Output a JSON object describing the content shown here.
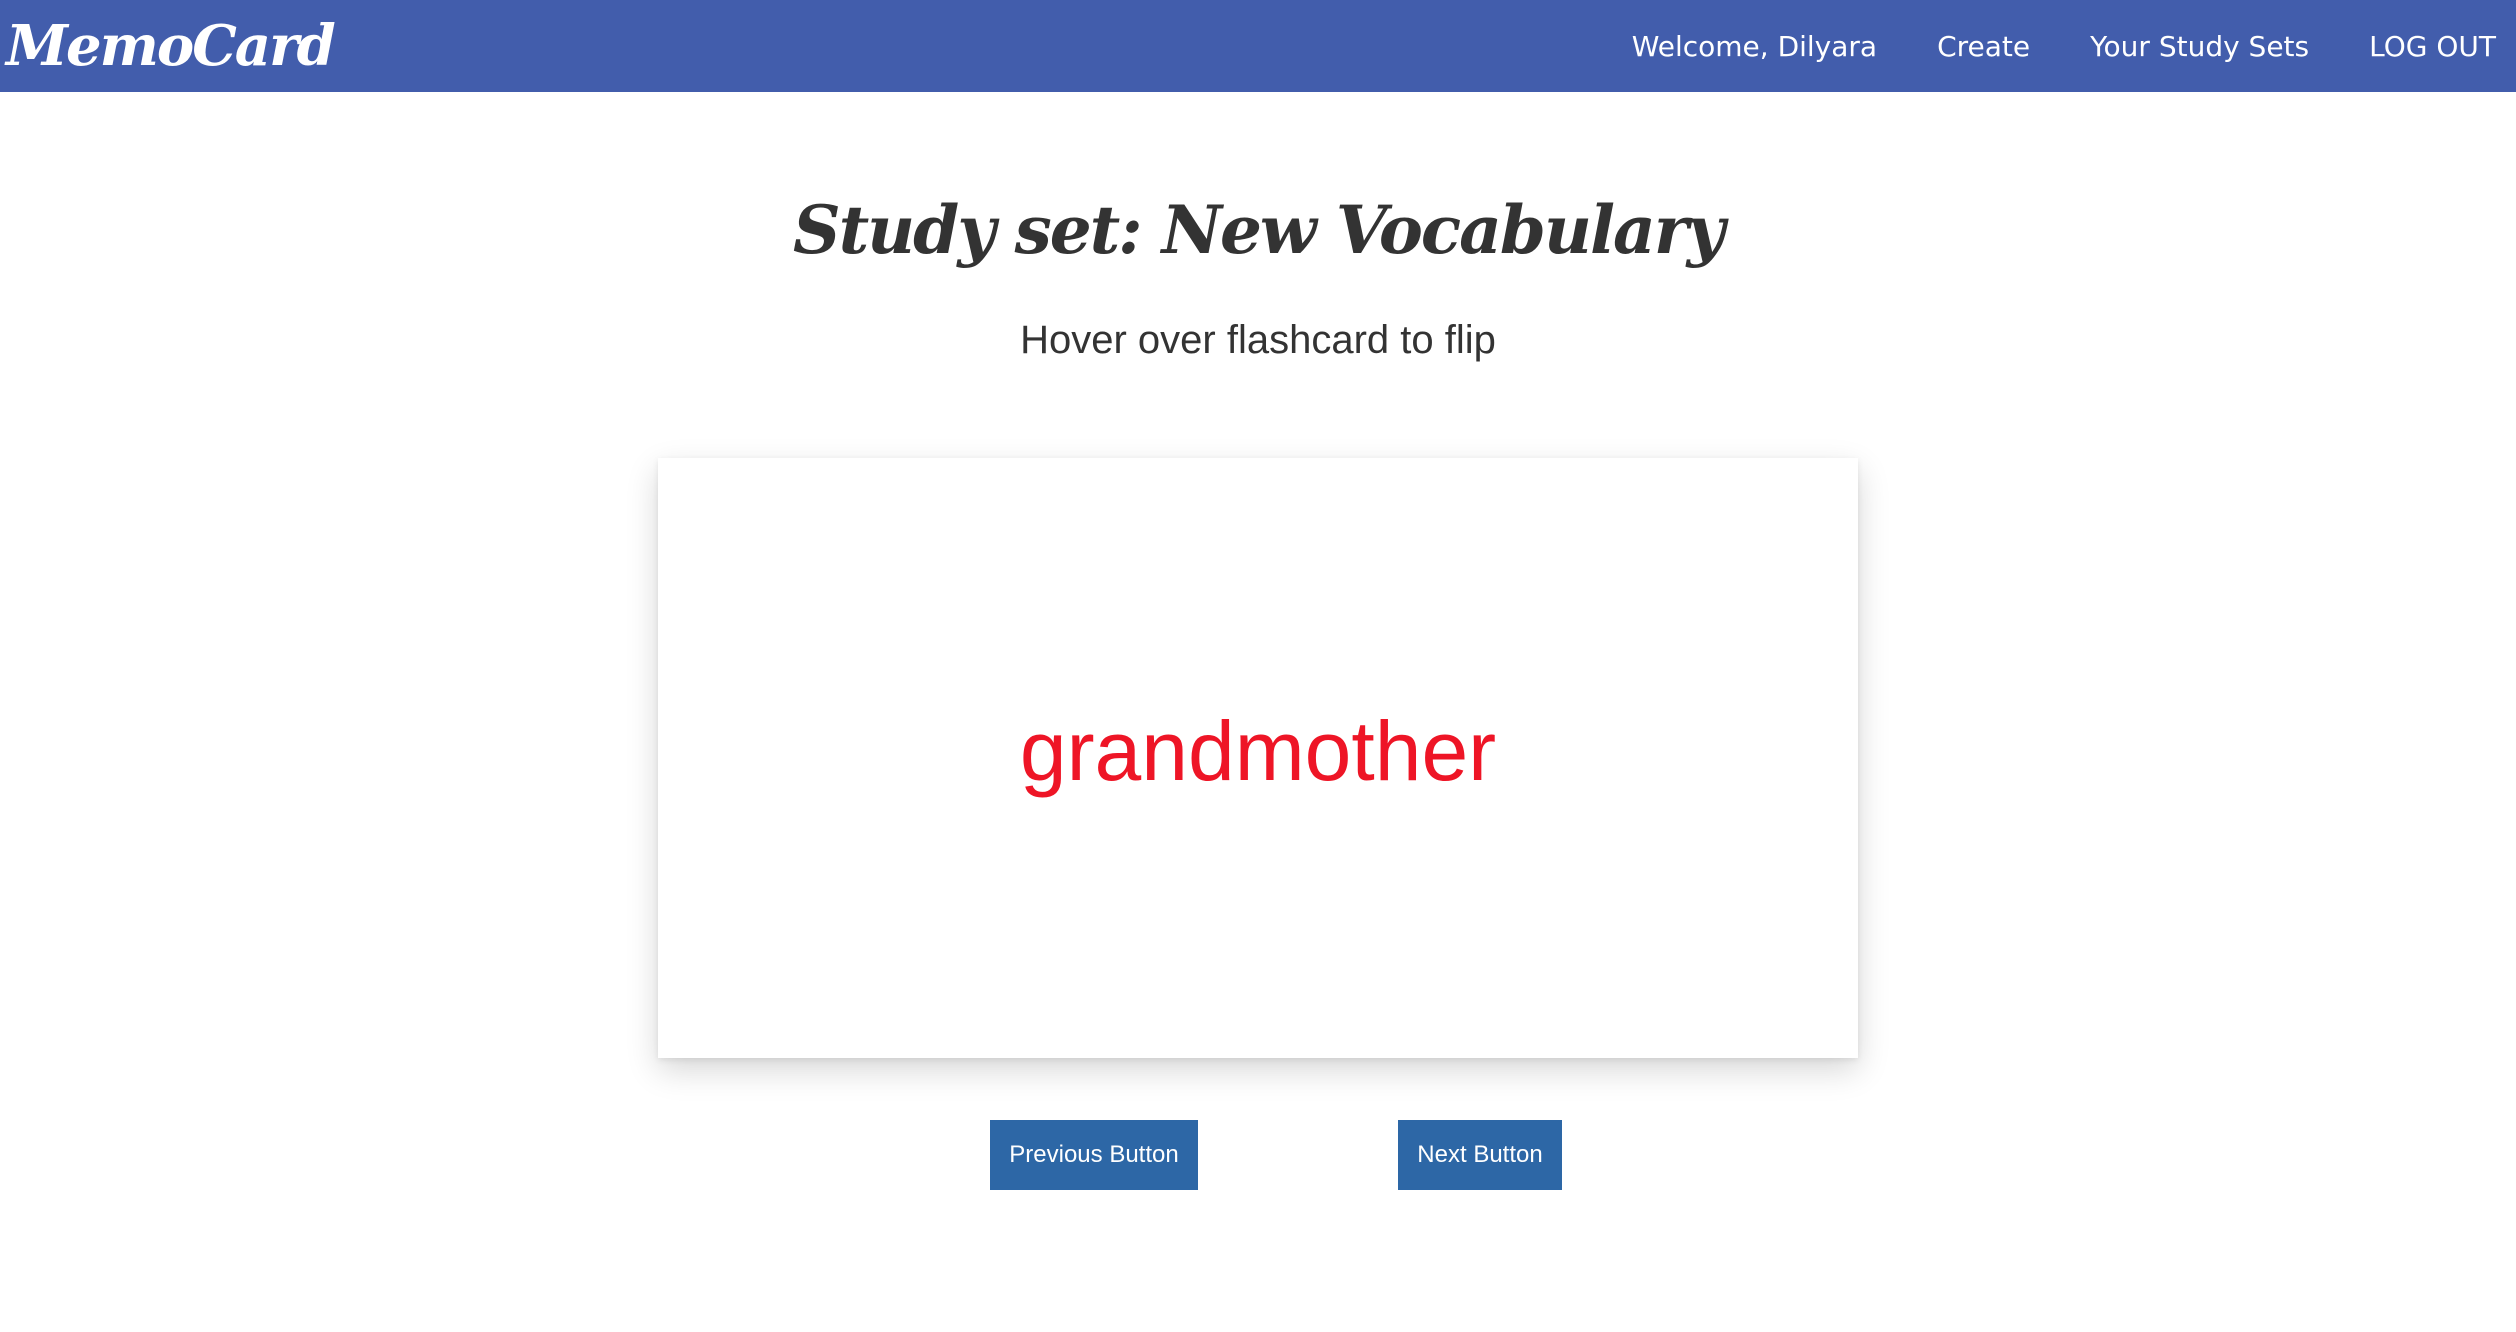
{
  "navbar": {
    "brand": "MemoCard",
    "welcome": "Welcome, Dilyara",
    "links": {
      "create": "Create",
      "study_sets": "Your Study Sets",
      "logout": "LOG OUT"
    }
  },
  "main": {
    "title": "Study set: New Vocabulary",
    "subtitle": "Hover over flashcard to flip",
    "flashcard": {
      "term": "grandmother"
    },
    "buttons": {
      "previous": "Previous Button",
      "next": "Next Button"
    }
  },
  "colors": {
    "navbar_bg": "#425dac",
    "term_text": "#ee1526",
    "button_bg": "#2d67a6"
  }
}
